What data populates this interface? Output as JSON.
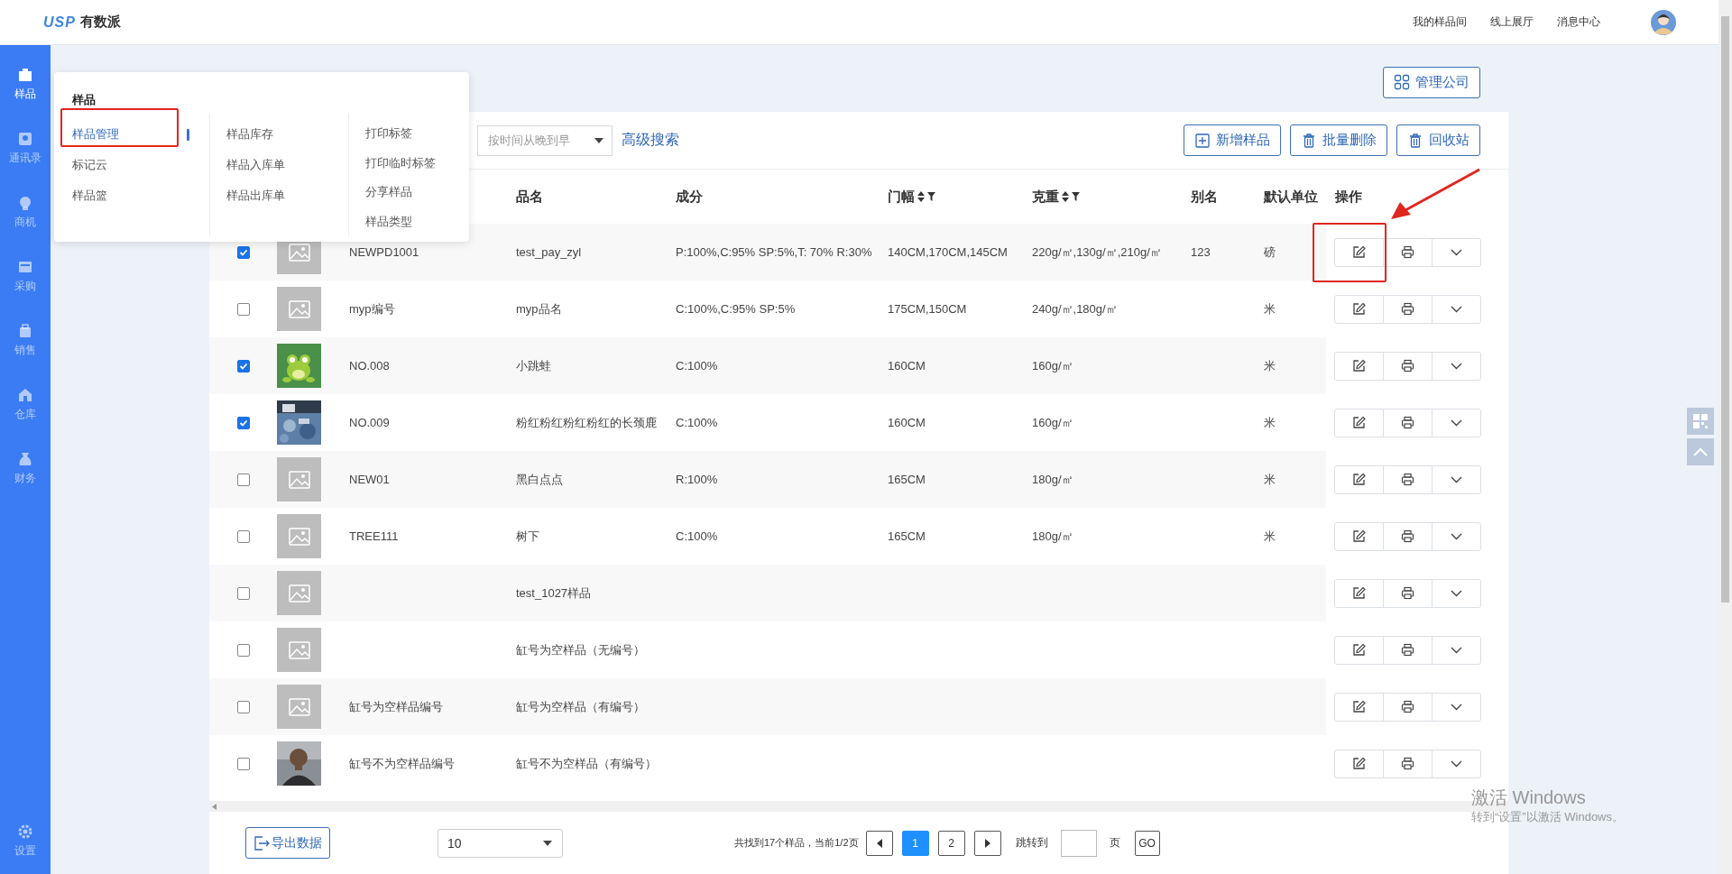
{
  "header": {
    "logo_mark": "USP",
    "logo_text": "有数派",
    "links": [
      "我的样品间",
      "线上展厅",
      "消息中心"
    ]
  },
  "sidebar": {
    "items": [
      {
        "label": "样品",
        "selected": true
      },
      {
        "label": "通讯录",
        "selected": false
      },
      {
        "label": "商机",
        "selected": false
      },
      {
        "label": "采购",
        "selected": false
      },
      {
        "label": "销售",
        "selected": false
      },
      {
        "label": "仓库",
        "selected": false
      },
      {
        "label": "财务",
        "selected": false
      }
    ],
    "footer_item": {
      "label": "设置"
    }
  },
  "flyout": {
    "title": "样品",
    "columns": [
      [
        {
          "label": "样品管理",
          "selected": true
        },
        {
          "label": "标记云",
          "selected": false
        },
        {
          "label": "样品篮",
          "selected": false
        }
      ],
      [
        {
          "label": "样品库存",
          "selected": false
        },
        {
          "label": "样品入库单",
          "selected": false
        },
        {
          "label": "样品出库单",
          "selected": false
        }
      ],
      [
        {
          "label": "打印标签",
          "selected": false
        },
        {
          "label": "打印临时标签",
          "selected": false
        },
        {
          "label": "分享样品",
          "selected": false
        },
        {
          "label": "样品类型",
          "selected": false
        }
      ]
    ]
  },
  "manage_company_button": "管理公司",
  "toolbar": {
    "sort_select": {
      "placeholder": "按时间从晚到早"
    },
    "advanced_search": "高级搜索",
    "buttons": [
      {
        "label": "新增样品",
        "kind": "add"
      },
      {
        "label": "批量删除",
        "kind": "delete"
      },
      {
        "label": "回收站",
        "kind": "delete"
      }
    ]
  },
  "table": {
    "columns": [
      {
        "label": "品名"
      },
      {
        "label": "成分"
      },
      {
        "label": "门幅",
        "filter": true
      },
      {
        "label": "克重",
        "filter": true
      },
      {
        "label": "别名"
      },
      {
        "label": "默认单位"
      },
      {
        "label": "操作"
      }
    ],
    "rows": [
      {
        "checked": true,
        "thumb": {
          "kind": "placeholder"
        },
        "code": "NEWPD1001",
        "name": "test_pay_zyl",
        "composition": "P:100%,C:95% SP:5%,T: 70% R:30%",
        "width": "140CM,170CM,145CM",
        "weight": "220g/㎡,130g/㎡,210g/㎡",
        "alias": "123",
        "unit": "磅"
      },
      {
        "checked": false,
        "thumb": {
          "kind": "placeholder"
        },
        "code": "myp编号",
        "name": "myp品名",
        "composition": "C:100%,C:95% SP:5%",
        "width": "175CM,150CM",
        "weight": "240g/㎡,180g/㎡",
        "unit": "米"
      },
      {
        "checked": true,
        "code": "NO.008",
        "name": "小跳蛙",
        "composition": "C:100%",
        "width": "160CM",
        "weight": "160g/㎡",
        "unit": "米"
      },
      {
        "checked": true,
        "code": "NO.009",
        "name": "粉红粉红粉红粉红的长颈鹿",
        "composition": "C:100%",
        "width": "160CM",
        "weight": "160g/㎡",
        "unit": "米"
      },
      {
        "checked": false,
        "thumb": {
          "kind": "placeholder"
        },
        "code": "NEW01",
        "name": "黑白点点",
        "composition": "R:100%",
        "width": "165CM",
        "weight": "180g/㎡",
        "unit": "米"
      },
      {
        "checked": false,
        "thumb": {
          "kind": "placeholder"
        },
        "code": "TREE111",
        "name": "树下",
        "composition": "C:100%",
        "width": "165CM",
        "weight": "180g/㎡",
        "unit": "米"
      },
      {
        "checked": false,
        "thumb": {
          "kind": "placeholder"
        },
        "name": "test_1027样品"
      },
      {
        "checked": false,
        "thumb": {
          "kind": "placeholder"
        },
        "name": "缸号为空样品（无编号）"
      },
      {
        "checked": false,
        "thumb": {
          "kind": "placeholder"
        },
        "code": "缸号为空样品编号",
        "name": "缸号为空样品（有编号）"
      },
      {
        "checked": false,
        "code": "缸号不为空样品编号",
        "name": "缸号不为空样品（有编号）"
      }
    ]
  },
  "footer": {
    "export_button": "导出数据",
    "page_size": {
      "value": "10"
    },
    "summary": "共找到17个样品，当前1/2页",
    "pages": [
      {
        "label": "1",
        "selected": true
      },
      {
        "label": "2",
        "selected": false
      }
    ],
    "jump_label": "跳转到",
    "page_unit": "页",
    "go_button": "GO"
  },
  "os_notice": {
    "title": "激活 Windows",
    "text": "转到“设置”以激活 Windows。"
  }
}
